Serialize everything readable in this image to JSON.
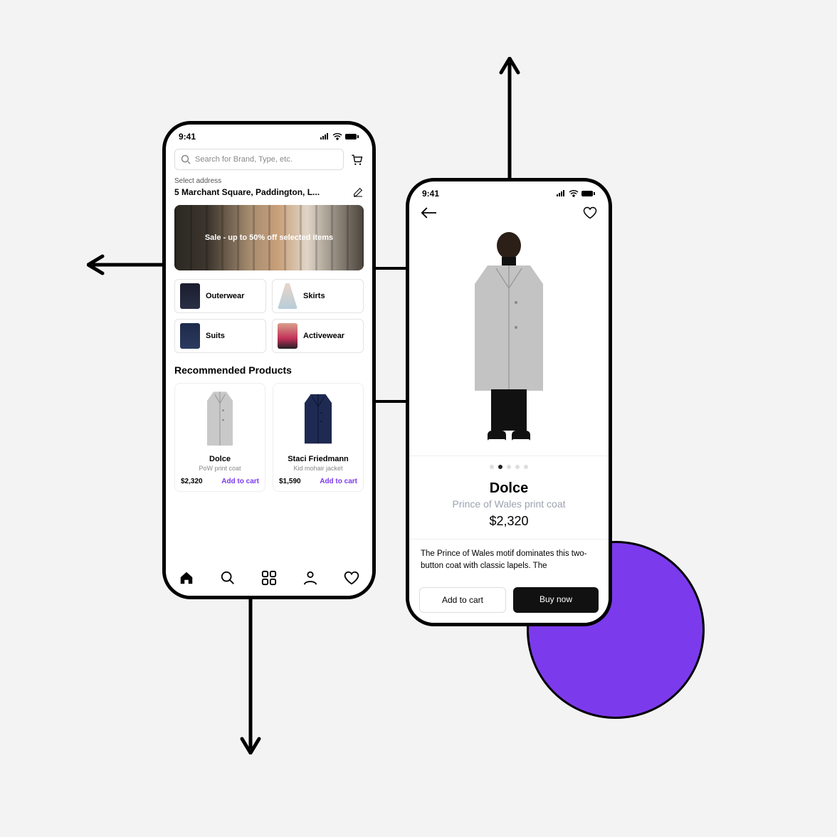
{
  "status": {
    "time": "9:41"
  },
  "home": {
    "search_placeholder": "Search for Brand, Type, etc.",
    "address_label": "Select address",
    "address_value": "5 Marchant Square, Paddington, L...",
    "sale_banner": "Sale - up to 50% off selected items",
    "categories": [
      {
        "label": "Outerwear"
      },
      {
        "label": "Skirts"
      },
      {
        "label": "Suits"
      },
      {
        "label": "Activewear"
      }
    ],
    "recommended_heading": "Recommended Products",
    "products": [
      {
        "brand": "Dolce",
        "name": "PoW print coat",
        "price": "$2,320",
        "cta": "Add to cart"
      },
      {
        "brand": "Staci Friedmann",
        "name": "Kid mohair jacket",
        "price": "$1,590",
        "cta": "Add to cart"
      }
    ]
  },
  "detail": {
    "brand": "Dolce",
    "name": "Prince of Wales print coat",
    "price": "$2,320",
    "description": "The Prince of Wales motif dominates this two-button coat with classic lapels. The",
    "add_to_cart": "Add to cart",
    "buy_now": "Buy now",
    "dots_total": 5,
    "dots_active_index": 1
  }
}
